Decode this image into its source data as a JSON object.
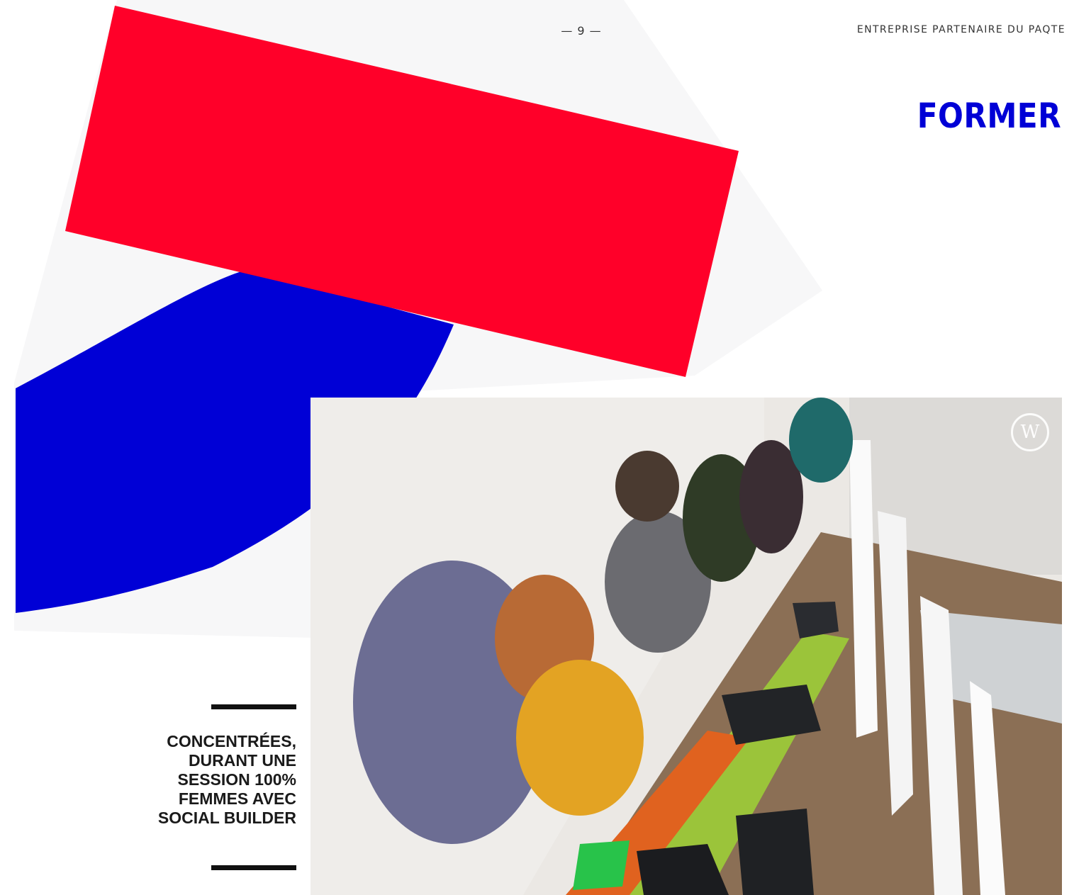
{
  "header": {
    "page_number": "— 9 —",
    "label": "ENTREPRISE PARTENAIRE DU PAQTE"
  },
  "section": {
    "title": "FORMER"
  },
  "photo": {
    "watermark": "W"
  },
  "caption": {
    "lines": [
      "CONCENTRÉES,",
      "DURANT UNE",
      "SESSION 100%",
      "FEMMES AVEC",
      "SOCIAL BUILDER"
    ]
  },
  "colors": {
    "red": "#ff0029",
    "blue": "#0000d6",
    "title_blue": "#0000d6",
    "caption_rule": "#111111"
  }
}
